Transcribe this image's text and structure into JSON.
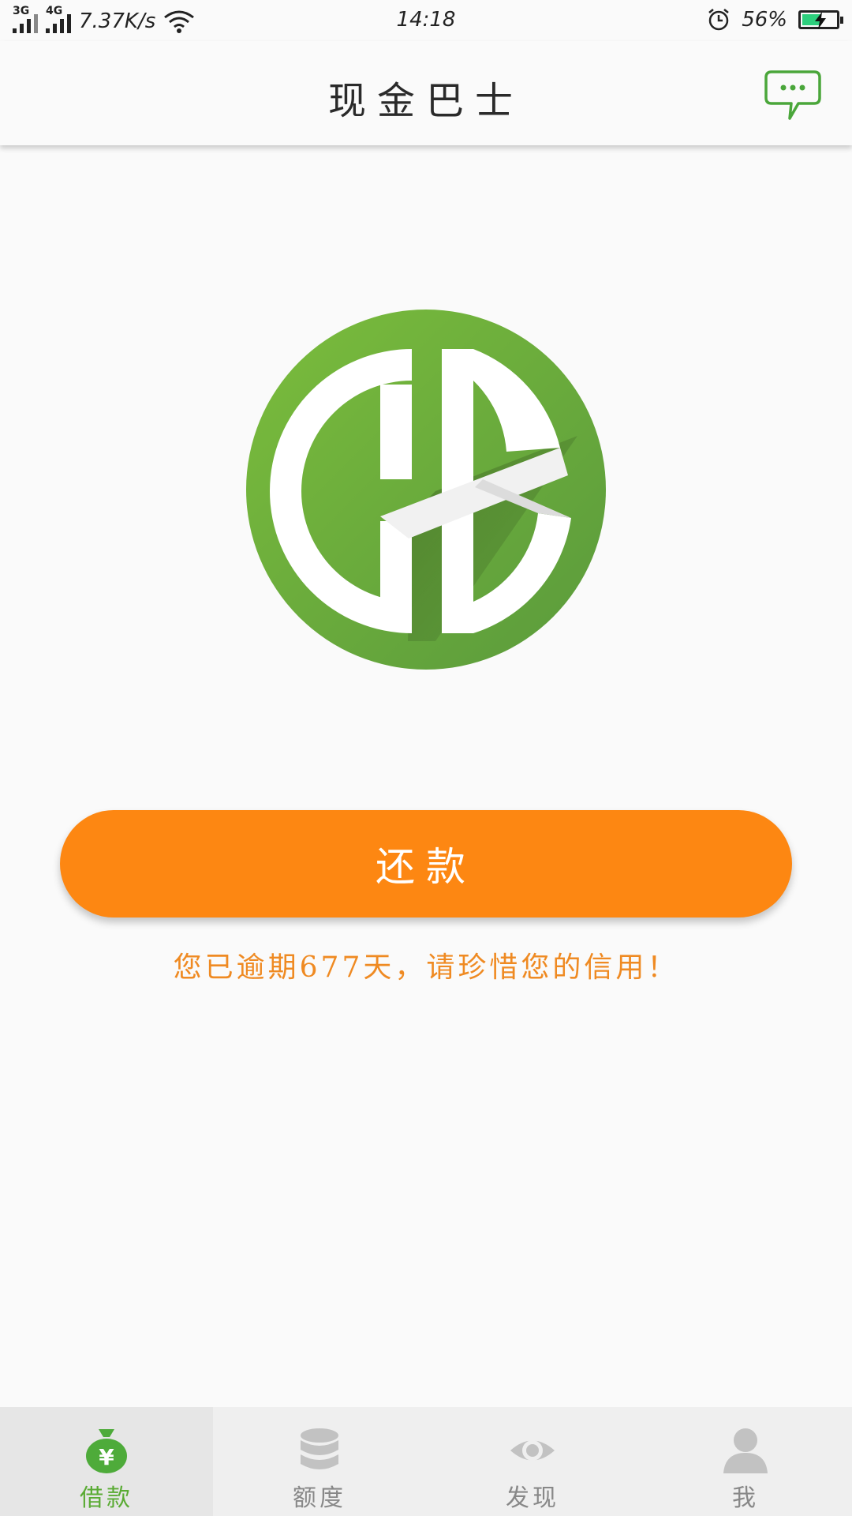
{
  "status_bar": {
    "network1": "3G",
    "network2": "4G",
    "speed": "7.37K/s",
    "time": "14:18",
    "battery_percent": "56%",
    "battery_level": 0.56,
    "battery_color": "#2dcf7d"
  },
  "header": {
    "title": "现金巴士",
    "message_icon": "chat-bubble-icon"
  },
  "logo": {
    "icon": "cb-logo",
    "color": "#6aad3c"
  },
  "main": {
    "repay_label": "还款",
    "overdue_message": "您已逾期677天，请珍惜您的信用！",
    "accent_color": "#fd8712"
  },
  "bottom_nav": {
    "items": [
      {
        "label": "借款",
        "icon": "money-bag-icon",
        "active": true
      },
      {
        "label": "额度",
        "icon": "database-icon",
        "active": false
      },
      {
        "label": "发现",
        "icon": "eye-icon",
        "active": false
      },
      {
        "label": "我",
        "icon": "person-icon",
        "active": false
      }
    ],
    "active_color": "#5aab34"
  }
}
